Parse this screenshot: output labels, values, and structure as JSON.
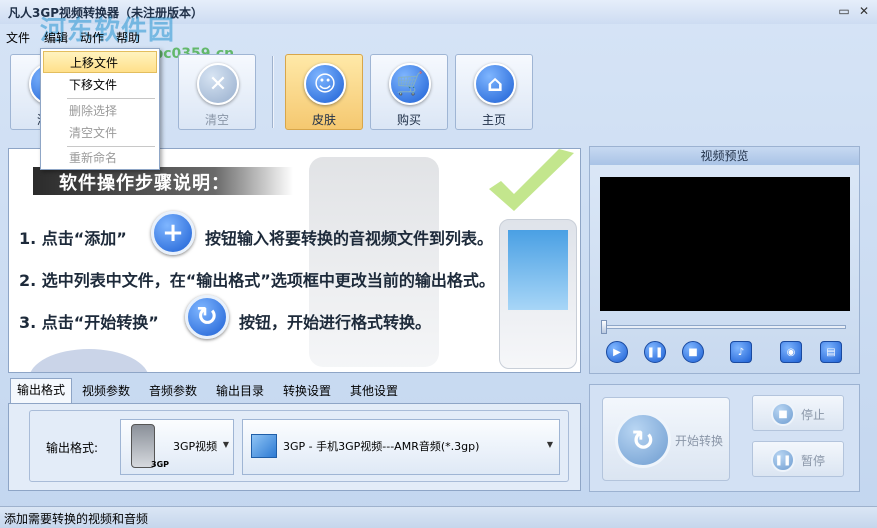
{
  "window": {
    "title": "凡人3GP视频转换器（未注册版本）",
    "watermark": "河东软件园",
    "watermark_url": "www.pc0359.cn",
    "controls": {
      "restore": "▭",
      "close": "✕"
    }
  },
  "menu": {
    "items": [
      "文件",
      "编辑",
      "动作",
      "帮助"
    ]
  },
  "dropdown": {
    "items": [
      {
        "label": "上移文件",
        "state": "highlight"
      },
      {
        "label": "下移文件",
        "state": "normal"
      },
      {
        "label": "删除选择",
        "state": "disabled"
      },
      {
        "label": "清空文件",
        "state": "disabled"
      },
      {
        "label": "重新命名",
        "state": "disabled"
      }
    ]
  },
  "toolbar": {
    "add_label": "添加",
    "clear_label": "清空",
    "skin_label": "皮肤",
    "buy_label": "购买",
    "home_label": "主页"
  },
  "instructions": {
    "heading": "软件操作步骤说明：",
    "step1_pre": "1. 点击“添加”",
    "step1_post": "按钮输入将要转换的音视频文件到列表。",
    "step2": "2. 选中列表中文件，在“输出格式”选项框中更改当前的输出格式。",
    "step3_pre": "3. 点击“开始转换”",
    "step3_post": "按钮，开始进行格式转换。"
  },
  "preview": {
    "title": "视频预览"
  },
  "tabs": {
    "items": [
      "输出格式",
      "视频参数",
      "音频参数",
      "输出目录",
      "转换设置",
      "其他设置"
    ],
    "active": 0
  },
  "output": {
    "label": "输出格式:",
    "device_name": "3GP视频",
    "device_sub": "3GP",
    "format": "3GP - 手机3GP视频---AMR音频(*.3gp)"
  },
  "convert": {
    "start_label": "开始转换",
    "stop_label": "停止",
    "pause_label": "暂停"
  },
  "status": {
    "text": "添加需要转换的视频和音频"
  },
  "colors": {
    "accent_blue": "#1c5fd4",
    "skin_active": "#f5c870",
    "window_bg": "#c9daf0"
  }
}
